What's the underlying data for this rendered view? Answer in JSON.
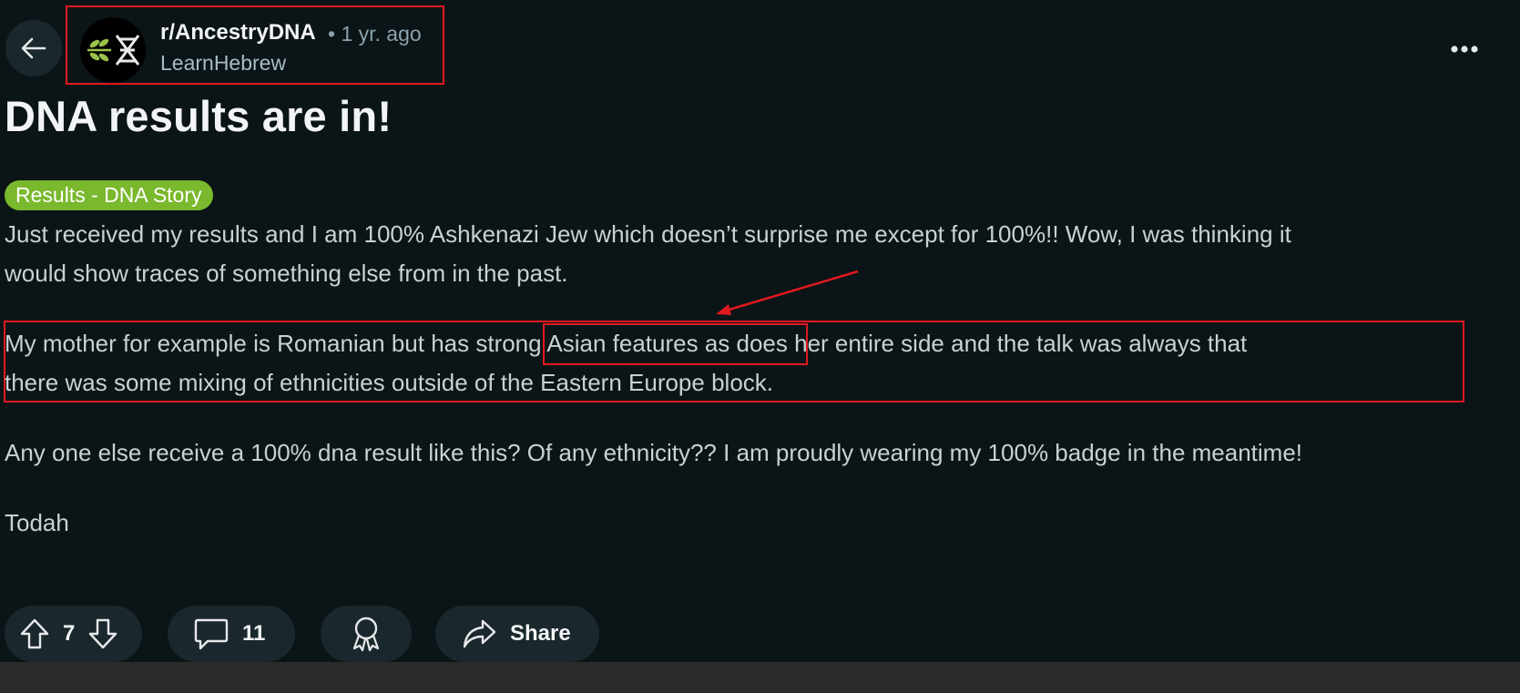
{
  "post": {
    "subreddit": "r/AncestryDNA",
    "separator": "•",
    "age": "1 yr. ago",
    "author": "LearnHebrew",
    "title": "DNA results are in!",
    "flair": "Results - DNA Story",
    "paragraphs": {
      "p1_line1": "Just received my results and I am 100% Ashkenazi Jew which doesn’t surprise me except for 100%!! Wow, I was thinking it",
      "p1_line2": "would show traces of something else from in the past.",
      "p2_line1_before": "My mother for example is Romanian but has ",
      "p2_line1_highlight": "strong Asian features",
      "p2_line1_after": " as does her entire side and the talk was always that",
      "p2_line2": "there was some mixing of ethnicities outside of the Eastern Europe block.",
      "p3": "Any one else receive a 100% dna result like this? Of any ethnicity?? I am proudly wearing my 100% badge in the meantime!",
      "p4": "Todah"
    }
  },
  "actions": {
    "votes": "7",
    "comments": "11",
    "share_label": "Share"
  },
  "icons": {
    "back": "arrow-left-icon",
    "more": "more-horizontal-icon",
    "upvote": "upvote-icon",
    "downvote": "downvote-icon",
    "comment": "comment-icon",
    "award": "award-icon",
    "share": "share-icon"
  },
  "colors": {
    "background": "#0b1416",
    "annotation_red": "#e0191f",
    "flair_green": "#7ab82d",
    "button_bg": "#1a282d"
  }
}
